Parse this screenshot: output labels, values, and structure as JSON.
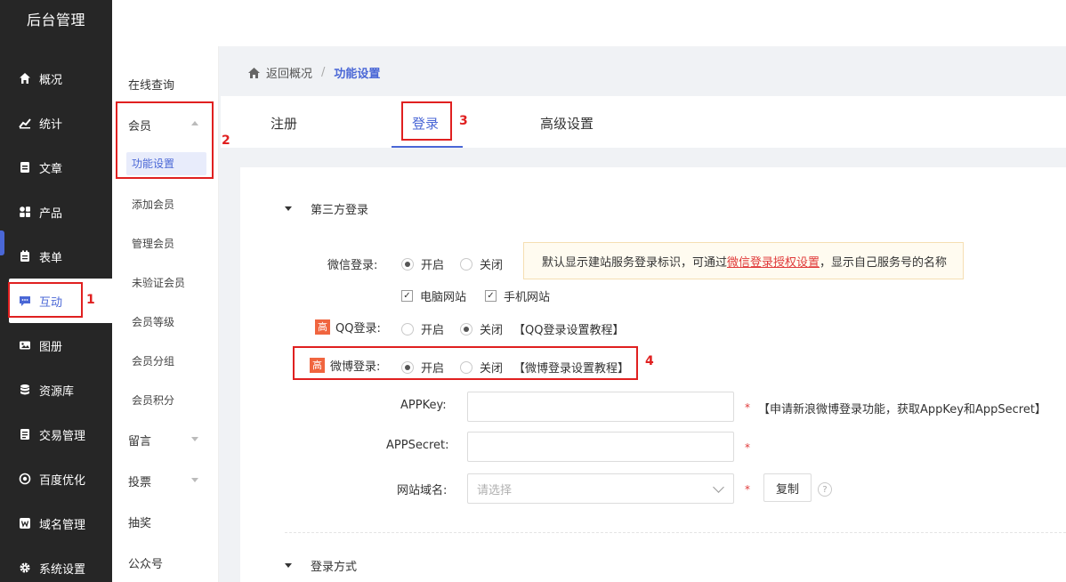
{
  "sidebar": {
    "brand": "后台管理",
    "items": [
      {
        "label": "概况",
        "icon": "home-icon"
      },
      {
        "label": "统计",
        "icon": "stats-icon"
      },
      {
        "label": "文章",
        "icon": "article-icon"
      },
      {
        "label": "产品",
        "icon": "product-icon"
      },
      {
        "label": "表单",
        "icon": "form-icon"
      },
      {
        "label": "互动",
        "icon": "chat-icon",
        "active": true
      },
      {
        "label": "图册",
        "icon": "album-icon"
      },
      {
        "label": "资源库",
        "icon": "database-icon"
      },
      {
        "label": "交易管理",
        "icon": "trade-icon"
      },
      {
        "label": "百度优化",
        "icon": "seo-icon"
      },
      {
        "label": "域名管理",
        "icon": "domain-icon"
      },
      {
        "label": "系统设置",
        "icon": "gear-icon"
      }
    ]
  },
  "submenu": {
    "online_query": "在线查询",
    "member": "会员",
    "function_settings": "功能设置",
    "add_member": "添加会员",
    "manage_member": "管理会员",
    "unverified_member": "未验证会员",
    "member_level": "会员等级",
    "member_group": "会员分组",
    "member_points": "会员积分",
    "message": "留言",
    "vote": "投票",
    "lottery": "抽奖",
    "official_account": "公众号"
  },
  "breadcrumb": {
    "back": "返回概况",
    "separator": "/",
    "current": "功能设置"
  },
  "tabs": [
    "注册",
    "登录",
    "高级设置"
  ],
  "section1": {
    "title": "第三方登录",
    "wechat_label": "微信登录:",
    "on": "开启",
    "off": "关闭",
    "notice_prefix": "默认显示建站服务登录标识，可通过",
    "notice_link": "微信登录授权设置",
    "notice_suffix": "，显示自己服务号的名称",
    "pc_site": "电脑网站",
    "mobile_site": "手机网站",
    "high_badge": "高",
    "qq_label": "QQ登录:",
    "qq_tutorial": "【QQ登录设置教程】",
    "weibo_label": "微博登录:",
    "weibo_tutorial": "【微博登录设置教程】",
    "appkey_label": "APPKey:",
    "appkey_hint": "【申请新浪微博登录功能，获取AppKey和AppSecret】",
    "appsecret_label": "APPSecret:",
    "domain_label": "网站域名:",
    "domain_placeholder": "请选择",
    "required_mark": "*",
    "copy_button": "复制",
    "help_mark": "?"
  },
  "section2": {
    "title": "登录方式"
  },
  "annotations": [
    "1",
    "2",
    "3",
    "4"
  ],
  "colors": {
    "accent": "#4a67d6",
    "sidebar_bg": "#262626",
    "annotation": "#e02020",
    "high_badge": "#f0653f"
  }
}
